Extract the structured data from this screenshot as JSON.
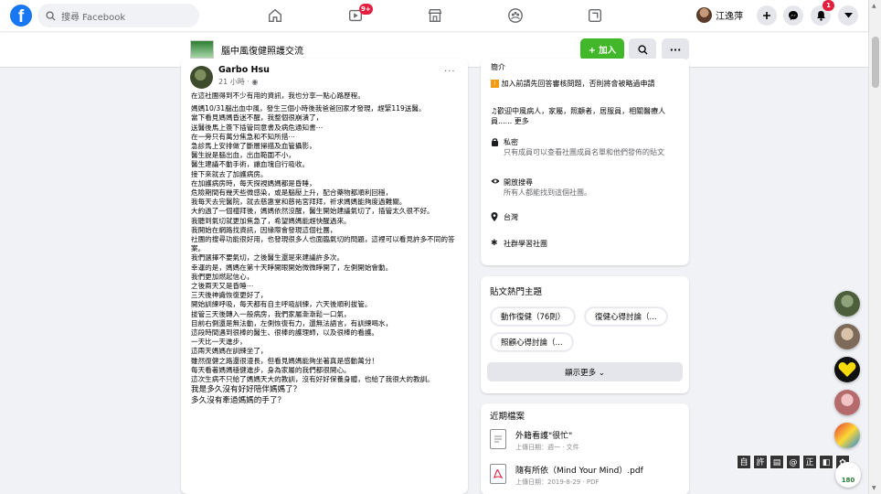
{
  "header": {
    "logo": "f",
    "search_placeholder": "搜尋 Facebook",
    "video_badge": "9+",
    "user_name": "江逸萍",
    "notif_badge": "1"
  },
  "group": {
    "name": "腦中風復健照護交流",
    "join_label": "+ 加入",
    "more_label": "···"
  },
  "post": {
    "author": "Garbo Hsu",
    "time": "21 小時 · ◉",
    "more": "···",
    "paragraphs": [
      "在這社團得到不少有用的資訊，我也分享一點心路歷程。",
      "",
      "媽媽10/31腦出血中風，發生三個小時後我爸爸回家才發現，趕緊119送醫。",
      "當下看見媽媽昏迷不醒，我整個很崩潰了，",
      "送醫後馬上簽下插管同意書及病危通知書⋯",
      "在一旁只有萬分焦急和不知所措⋯",
      "急診馬上安排做了斷層掃描及血管攝影，",
      "醫生說是腦出血，出血範圍不小，",
      "醫生建議不動手術，讓血塊自行吸收。",
      "接下來就去了加護病房。",
      "在加護病房時，每天探視媽媽都是昏睡，",
      "危險期間有幾天些微感染，或是腦壓上升，配合藥物都順利回穩，",
      "我每天去完醫院，就去慈惠堂和慈祐宮拜拜，祈求媽媽能夠度過難關。",
      "大約過了一個禮拜後，媽媽依然沒醒，醫生開始建議氣切了，插管太久很不好。",
      "我聽到氣切就更加焦急了，希望媽媽能趕快醒過來。",
      "我開始在網路找資訊，因緣際會發現這個社團，",
      "社團的搜尋功能很好用，也發現很多人也面臨氣切的問題，這裡可以看見許多不同的答案。",
      "我們選擇不要氣切，之後醫生還是來建議許多次。",
      "幸運的是，媽媽在第十天睜開眼開始微微睜開了，左側開始會動。",
      "我們更加燃起信心，",
      "之後兩天又是昏睡⋯",
      "三天後神識恢復更好了，",
      "開始訓練呼吸，每天都有自主呼吸訓練，六天後順利拔管。",
      "拔管三天後轉入一般病房，我們家屬漸漸鬆一口氣，",
      "目前右側還是無法動，左側恢復有力，還無法語言，有訓練喝水，",
      "這段時間遇到很棒的醫生、很棒的護理師，以及很棒的看護。",
      "一天比一天進步，",
      "這兩天媽媽在訓練坐了，",
      "雖然復健之路還很漫長，但看見媽媽能夠坐著真是感動萬分！",
      "每天看著媽媽穩健進步，身為家屬的我們都很開心。",
      "這次生病不只給了媽媽天大的教訓，沒有好好保養身體，也給了我很大的教訓。",
      "我是多久沒有好好陪伴媽媽了？",
      "多久沒有牽過媽媽的手了？"
    ]
  },
  "about": {
    "title": "簡介",
    "line1": "加入前請先回答審核問題，否則將會被略過申請",
    "line2": "歡迎中風病人，家屬，照顧者，居服員，相關醫療人員...... 更多",
    "private_title": "私密",
    "private_desc": "只有成員可以查看社團成員名單和他們發佈的貼文",
    "visible_title": "開放搜尋",
    "visible_desc": "所有人都能找到這個社團。",
    "location": "台灣",
    "category": "社群學習社團"
  },
  "topics": {
    "title": "貼文熱門主題",
    "chips": [
      "動作復健（76則）",
      "復健心得討論（...",
      "照顧心得討論（..."
    ],
    "more_label": "顯示更多 ⌄"
  },
  "files": {
    "title": "近期檔案",
    "items": [
      {
        "name": "外籍看護\"很忙\"",
        "meta": "上傳日期：週一 · 文件"
      },
      {
        "name": "隨有所依（Mind Your Mind）.pdf",
        "meta": "上傳日期：2019-8-29 · PDF"
      }
    ]
  },
  "toolbar": {
    "chars": [
      "自",
      "許",
      "▤",
      "@",
      "正",
      "◧",
      "✿"
    ],
    "dial": "180"
  },
  "colors": {
    "brand": "#1877f2",
    "join": "#42b72a",
    "badge": "#e41e3f"
  }
}
